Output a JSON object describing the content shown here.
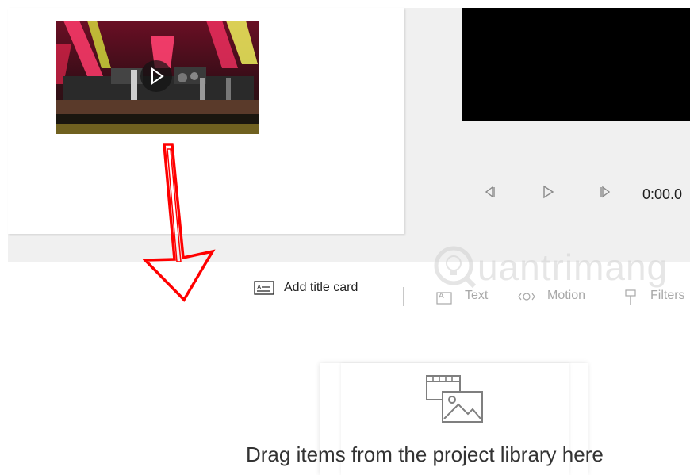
{
  "player": {
    "time": "0:00.0"
  },
  "toolbar": {
    "add_title_card": "Add title card",
    "text": "Text",
    "motion": "Motion",
    "filters": "Filters"
  },
  "storyboard": {
    "drop_message": "Drag items from the project library here"
  },
  "watermark": {
    "text": "uantrimang"
  },
  "colors": {
    "annotation_arrow": "#ff0000",
    "preview_background": "#000000",
    "panel_background": "#f0f0f0",
    "disabled_text": "#a8a8a8"
  },
  "icons": {
    "play": "play-icon",
    "previous_frame": "previous-frame-icon",
    "next_frame": "next-frame-icon",
    "title_card": "title-card-icon",
    "text": "text-icon",
    "motion": "motion-icon",
    "filters": "filters-icon",
    "drop_media": "media-placeholder-icon"
  }
}
